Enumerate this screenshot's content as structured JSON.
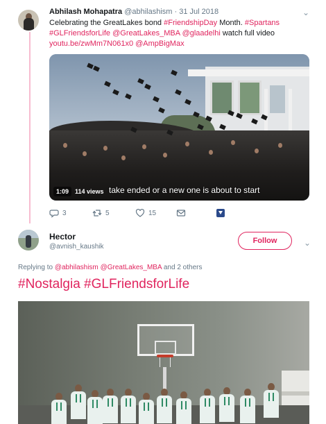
{
  "tweet": {
    "author_name": "Abhilash Mohapatra",
    "author_handle": "@abhilashism",
    "separator": "·",
    "date": "31 Jul 2018",
    "text_line1_pre": "Celebrating the GreatLakes bond ",
    "text_line1_tag1": "#FriendshipDay",
    "text_line1_mid": " Month. ",
    "text_line1_tag2": "#Spartans",
    "text_line2_tag": "#GLFriendsforLife",
    "text_line2_sp1": " ",
    "text_line2_m1": "@GreatLakes_MBA",
    "text_line2_sp2": " ",
    "text_line2_m2": "@glaadelhi",
    "text_line2_post": "  watch full video",
    "text_line3_link": "youtu.be/zwMm7N061x0",
    "text_line3_sp": " ",
    "text_line3_m": "@AmpBigMax",
    "video": {
      "time": "1:09",
      "views": "114 views",
      "subtitle": "take ended or a new one is about to start"
    },
    "actions": {
      "reply_count": "3",
      "retweet_count": "5",
      "like_count": "15"
    }
  },
  "reply": {
    "author_name": "Hector",
    "author_handle": "@avnish_kaushik",
    "follow_label": "Follow",
    "replying_prefix": "Replying to ",
    "replying_user1": "@abhilashism",
    "replying_sp": " ",
    "replying_user2": "@GreatLakes_MBA",
    "replying_suffix": " and 2 others",
    "text": "#Nostalgia #GLFriendsforLife"
  },
  "colors": {
    "accent": "#e0245e",
    "secondary_text": "#657786",
    "thread_line": "#f7bcd0"
  }
}
